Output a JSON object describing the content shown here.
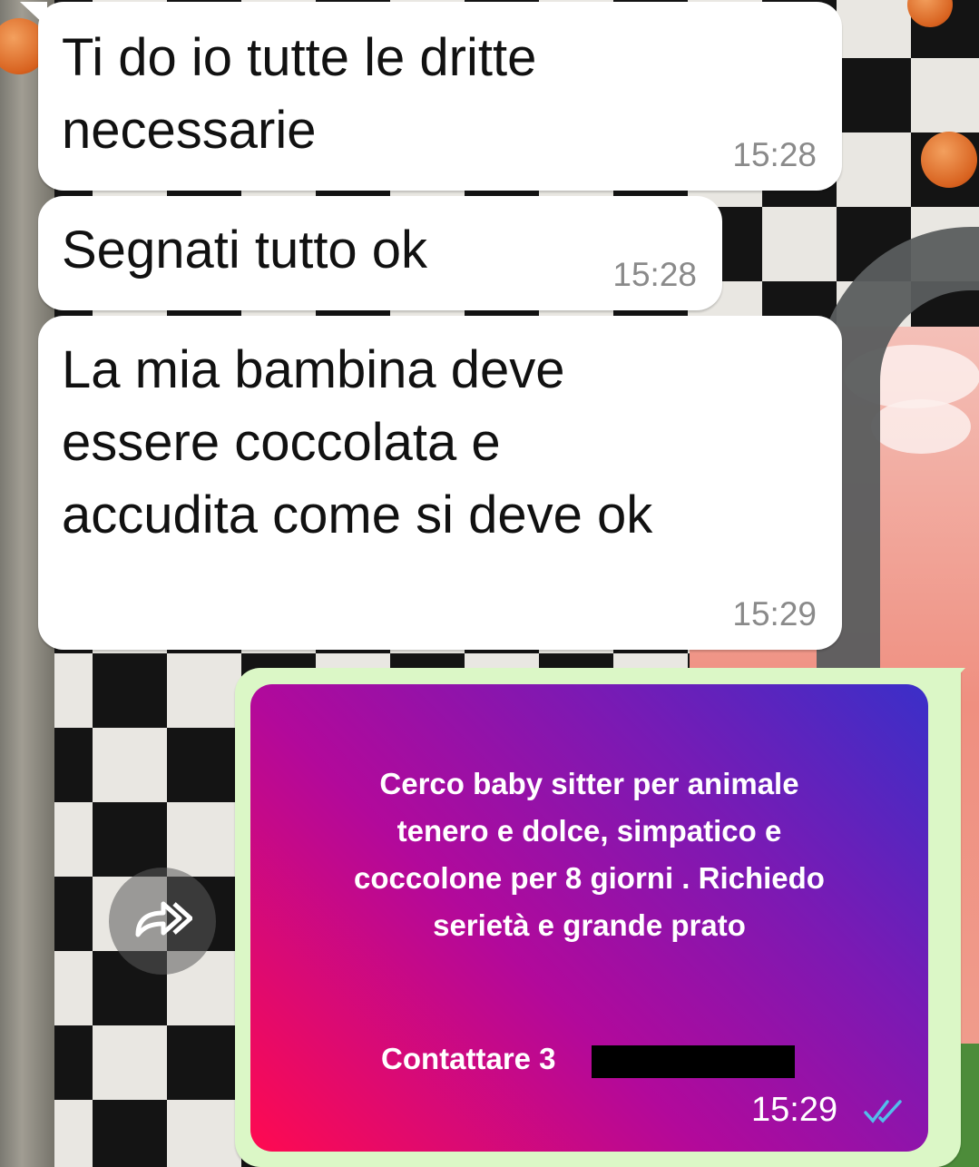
{
  "messages": [
    {
      "text": "Ti do io tutte le dritte\nnecessarie",
      "time": "15:28",
      "direction": "incoming"
    },
    {
      "text": "Segnati tutto ok",
      "time": "15:28",
      "direction": "incoming"
    },
    {
      "text": "La mia bambina deve\nessere coccolata e\naccudita come si deve ok",
      "time": "15:29",
      "direction": "incoming"
    }
  ],
  "outgoing_image": {
    "story_text": "Cerco baby sitter per animale\ntenero e dolce, simpatico e\ncoccolone per 8 giorni . Richiedo\nserietà e grande prato",
    "contact_text": "Contattare 3",
    "time": "15:29",
    "status_icon": "double-check-icon",
    "status_color": "#53bdeb"
  },
  "forward_icon": "forward-icon",
  "colors": {
    "incoming_bubble": "#ffffff",
    "outgoing_bubble": "#dbf7c6",
    "time_text": "#8a8a8a"
  }
}
